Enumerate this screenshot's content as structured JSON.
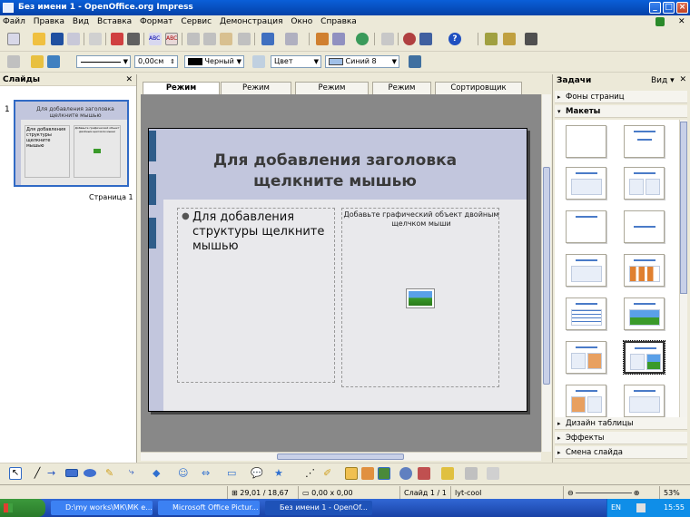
{
  "window": {
    "title": "Без имени 1 - OpenOffice.org Impress"
  },
  "menu": [
    "Файл",
    "Правка",
    "Вид",
    "Вставка",
    "Формат",
    "Сервис",
    "Демонстрация",
    "Окно",
    "Справка"
  ],
  "line_toolbar": {
    "width_value": "0,00см",
    "color_value": "Черный",
    "area_type": "Цвет",
    "area_color": "Синий 8"
  },
  "slides_pane": {
    "title": "Слайды",
    "thumb_number": "1",
    "thumb_title": "Для добавления заголовка щелкните мышью",
    "thumb_body": "Для добавления структуры щелкните мышью",
    "thumb_object_text": "Добавьте графический объект двойным щелчком мыши",
    "thumb_label": "Страница 1"
  },
  "view_tabs": [
    "Режим рисования",
    "Режим структуры",
    "Режим примечаний",
    "Режим тезисов",
    "Сортировщик слайдов"
  ],
  "slide": {
    "title": "Для добавления заголовка щелкните мышью",
    "body": "Для добавления структуры щелкните мышью",
    "object_hint": "Добавьте графический объект двойным щелчком мыши"
  },
  "task_pane": {
    "title": "Задачи",
    "view_label": "Вид",
    "sections_top": [
      "Фоны страниц",
      "Макеты"
    ],
    "sections_bottom": [
      "Дизайн таблицы",
      "Эффекты",
      "Смена слайда"
    ]
  },
  "status": {
    "position": "29,01 / 18,67",
    "size": "0,00 x 0,00",
    "slide": "Слайд 1 / 1",
    "design": "lyt-cool",
    "zoom": "53%"
  },
  "taskbar": {
    "items": [
      "D:\\my works\\МК\\МК е...",
      "Microsoft Office Pictur...",
      "Без имени 1 - OpenOf..."
    ],
    "lang": "EN",
    "clock": "15:55"
  },
  "colors": {
    "accent": "#316ac5",
    "slide_header": "#c2c6dd",
    "side_tabs": "#2f5d8a"
  }
}
